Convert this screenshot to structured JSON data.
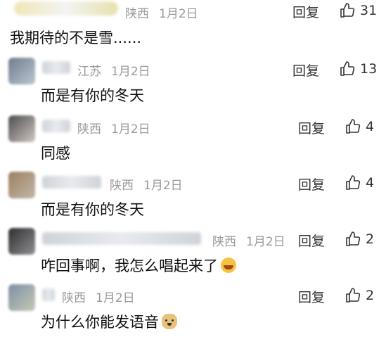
{
  "comments": [
    {
      "location": "陕西",
      "date": "1月2日",
      "reply": "回复",
      "likes": "31",
      "text": "我期待的不是雪......",
      "emoji": ""
    },
    {
      "location": "江苏",
      "date": "1月2日",
      "reply": "回复",
      "likes": "13",
      "text": "而是有你的冬天",
      "emoji": ""
    },
    {
      "location": "陕西",
      "date": "1月2日",
      "reply": "回复",
      "likes": "4",
      "text": "同感",
      "emoji": ""
    },
    {
      "location": "陕西",
      "date": "1月2日",
      "reply": "回复",
      "likes": "4",
      "text": "而是有你的冬天",
      "emoji": ""
    },
    {
      "location": "陕西",
      "date": "1月2日",
      "reply": "回复",
      "likes": "2",
      "text": "咋回事啊，我怎么唱起来了",
      "emoji": "laugh-cry-emoji"
    },
    {
      "location": "陕西",
      "date": "1月2日",
      "reply": "回复",
      "likes": "2",
      "text": "为什么你能发语音",
      "emoji": "doge-emoji"
    }
  ],
  "icons": {
    "like": "thumbs-up-icon"
  },
  "colors": {
    "meta": "#9a9a9a",
    "text": "#111111",
    "action": "#333333"
  }
}
